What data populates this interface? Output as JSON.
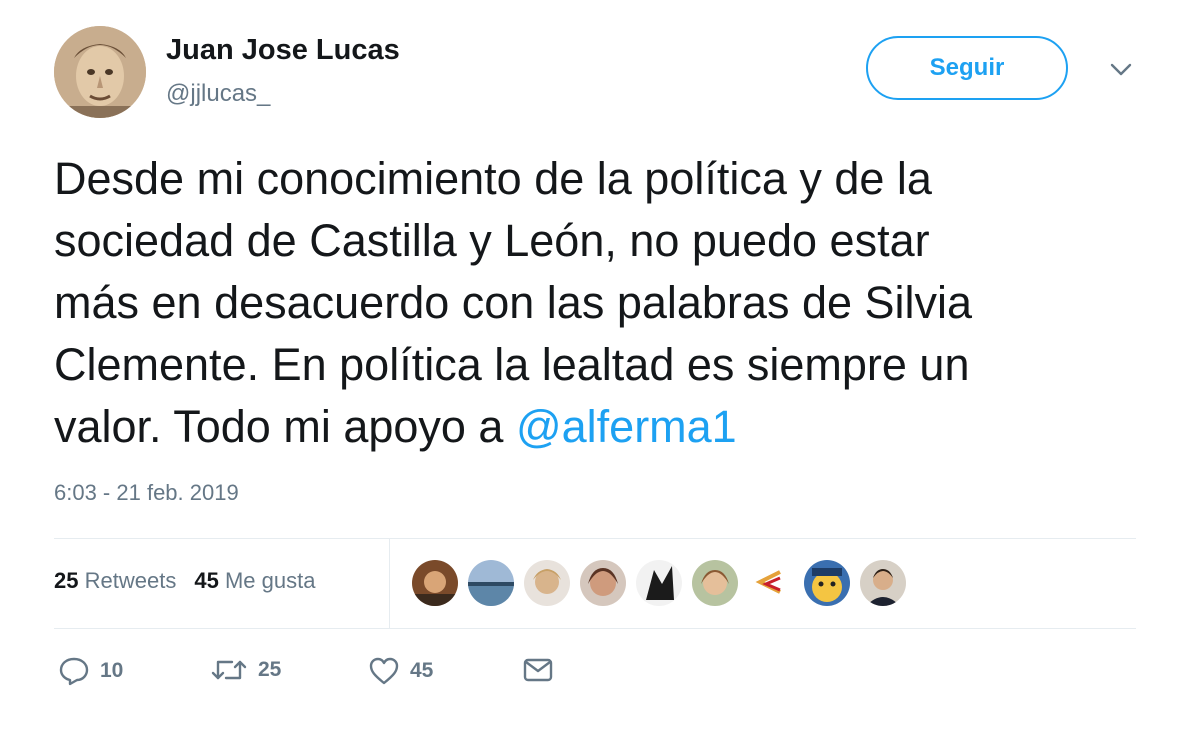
{
  "author": {
    "name": "Juan Jose Lucas",
    "handle": "@jjlucas_"
  },
  "follow_button": {
    "label": "Seguir"
  },
  "tweet": {
    "lines": [
      "Desde mi conocimiento de la política y de la",
      "sociedad de Castilla y León, no puedo estar",
      "más en desacuerdo con las palabras de Silvia",
      "Clemente. En política la lealtad es siempre un",
      "valor. Todo mi apoyo a "
    ],
    "mention": "@alferma1",
    "timestamp": "6:03 - 21 feb. 2019"
  },
  "stats": {
    "retweets_count": "25",
    "retweets_label": "Retweets",
    "likes_count": "45",
    "likes_label": "Me gusta"
  },
  "actions": {
    "reply_count": "10",
    "retweet_count": "25",
    "like_count": "45"
  },
  "colors": {
    "accent": "#1da1f2",
    "secondary_text": "#657786",
    "divider": "#e6ecf0"
  },
  "icons": [
    "chevron-down-icon",
    "reply-icon",
    "retweet-icon",
    "heart-icon",
    "mail-icon"
  ]
}
